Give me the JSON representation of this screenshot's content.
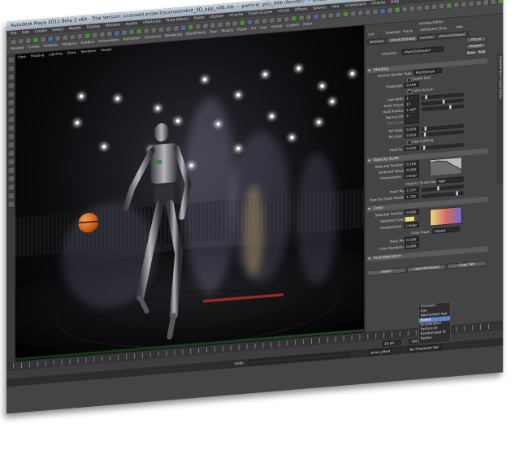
{
  "window": {
    "title": "Autodesk Maya 2011 Beta 2 x64 - Trial Version: Licensed project/scenes/robot_3D_app_v06.mb --- particle: ptcl_006 (Render) --- amber",
    "minimize": "_",
    "maximize": "□",
    "close": "✕"
  },
  "menubar": [
    "File",
    "Edit",
    "Create",
    "Select",
    "Modify",
    "Display",
    "Window",
    "Assets",
    "nParticles",
    "Fluid Effects",
    "Fields",
    "nSolver",
    "nCache",
    "Fluid nCache",
    "nCloth",
    "Effects",
    "Solvers",
    "Hair",
    "nConstraint",
    "nCache",
    "Help"
  ],
  "shelf": {
    "tabs": [
      "General",
      "Curves",
      "Surfaces",
      "Polygons",
      "Subdivs",
      "Deformation",
      "Animation",
      "Dynamics",
      "Rendering",
      "PaintEffects",
      "Toon",
      "Muscle",
      "Fluids",
      "Fur",
      "Hair",
      "nCloth",
      "Custom",
      "XGen"
    ]
  },
  "viewport": {
    "menu": [
      "View",
      "Shading",
      "Lighting",
      "Show",
      "Renderer",
      "Panels"
    ],
    "status": "persp"
  },
  "attribute_editor": {
    "title": "window-Editor",
    "menu": [
      "List",
      "Selected",
      "Focus",
      "Attributes",
      "Show",
      "Help"
    ],
    "tabs": [
      "emitter1",
      "nParticleShape1",
      "nucleus1",
      "nParticleShape2"
    ],
    "node_label": "nParticle:",
    "node_value": "nParticleShape1",
    "focus_btn": "Focus",
    "presets_btn": "Presets*",
    "show_btn": "Show",
    "hide_btn": "Hide",
    "shading": {
      "header": "Shading",
      "render_type_label": "Particle Render Type",
      "render_type_value": "MultiStreak",
      "depth_sort": "Depth Sort",
      "threshold_label": "Threshold",
      "threshold_value": "0.100",
      "color_accum": "Color Accum",
      "line_width_label": "Line Width",
      "line_width_value": "1",
      "multi_count_label": "Multi Count",
      "multi_count_value": "17",
      "multi_radius_label": "Multi Radius",
      "multi_radius_value": "1.407",
      "normal_dir_label": "Normal Dir",
      "normal_dir_value": "2",
      "point_size_label": "Point Size",
      "point_size_value": "",
      "tail_fade_label": "Tail Fade",
      "tail_fade_value": "0.039",
      "tail_size_label": "Tail Size",
      "tail_size_value": "0.010",
      "use_lighting": "Use Lighting",
      "opacity_label": "Opacity",
      "opacity_value": "0.010"
    },
    "opacity_scale": {
      "header": "Opacity Scale",
      "selected_position_label": "Selected Position",
      "selected_position_value": "0.163",
      "selected_value_label": "Selected Value",
      "selected_value_value": "0.000",
      "interpolation_label": "Interpolation",
      "interpolation_value": "Linear",
      "input_label": "Opacity Scale Input",
      "input_value": "Age",
      "input_max_label": "Input Max",
      "input_max_value": "2.247",
      "randomize_label": "Opacity Scale Randomize",
      "randomize_value": "1.762"
    },
    "color": {
      "header": "Color",
      "selected_position_label": "Selected Position",
      "selected_position_value": "0.000",
      "selected_color_label": "Selected Color",
      "interpolation_label": "Interpolation",
      "interpolation_value": "Linear",
      "input_label": "Color Input",
      "input_value": "Speed",
      "input_max_label": "Input Max",
      "input_max_value": "0.036",
      "randomize_label": "Color Randomize",
      "randomize_value": "0.000",
      "dropdown_options": [
        "Constant",
        "Age",
        "Normalized Age",
        "Speed",
        "Acceleration",
        "Particle ID",
        "Randomized ID",
        "Radius"
      ],
      "dropdown_selected": "Speed"
    },
    "incandescence_header": "Incandescence",
    "footer_buttons": [
      "Select",
      "Load Attributes",
      "Copy Tab"
    ],
    "side_tab": "Channel Box / Layer Editor"
  },
  "timeline": {
    "current_frame": "26.00",
    "range_end": "100.00",
    "anim_layer": "anim_offset",
    "character_set": "No Character Set"
  },
  "command_line": {
    "mode": "Undo",
    "value": ""
  },
  "colors": {
    "selected_color": "#e9db7a",
    "dropdown_highlight": "#5f86c8"
  }
}
